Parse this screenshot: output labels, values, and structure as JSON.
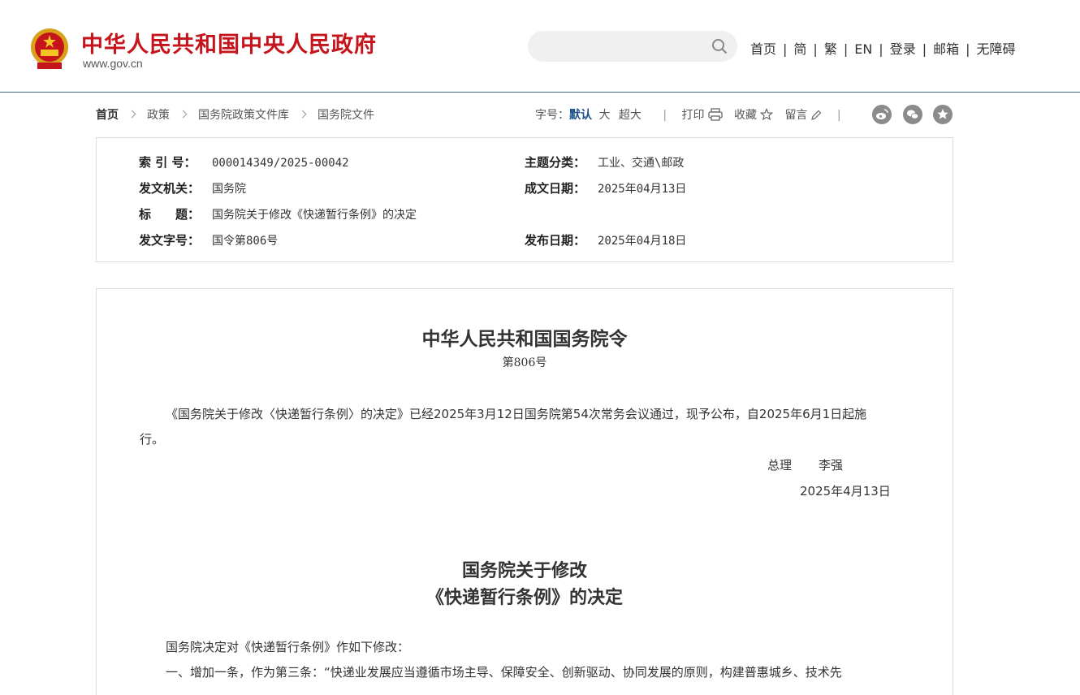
{
  "header": {
    "site_title": "中华人民共和国中央人民政府",
    "site_url": "www.gov.cn",
    "search": {
      "placeholder": "",
      "icon": "search-icon"
    },
    "nav": [
      "首页",
      "简",
      "繁",
      "EN",
      "登录",
      "邮箱",
      "无障碍"
    ]
  },
  "breadcrumb": [
    "首页",
    "政策",
    "国务院政策文件库",
    "国务院文件"
  ],
  "tools": {
    "font_size_label": "字号：",
    "font_sizes": [
      "默认",
      "大",
      "超大"
    ],
    "print": "打印",
    "favorite": "收藏",
    "comment": "留言",
    "share_icons": [
      "weibo-icon",
      "wechat-icon",
      "star-icon"
    ]
  },
  "info": {
    "index_label": "索 引 号：",
    "index_value": "000014349/2025-00042",
    "category_label": "主题分类：",
    "category_value": "工业、交通\\邮政",
    "issuer_label": "发文机关：",
    "issuer_value": "国务院",
    "written_label": "成文日期：",
    "written_value": "2025年04月13日",
    "title_label": "标　　题：",
    "title_value": "国务院关于修改《快递暂行条例》的决定",
    "docno_label": "发文字号：",
    "docno_value": "国令第806号",
    "published_label": "发布日期：",
    "published_value": "2025年04月18日"
  },
  "article": {
    "order_title": "中华人民共和国国务院令",
    "order_no": "第806号",
    "para1_line1": "《国务院关于修改〈快递暂行条例〉的决定》已经2025年3月12日国务院第54次常务会议通过，现予公布，自2025年6月1日起施",
    "para1_line2": "行。",
    "signer_title": "总理",
    "signer_name": "李强",
    "sign_date": "2025年4月13日",
    "decision_title_1": "国务院关于修改",
    "decision_title_2": "《快递暂行条例》的决定",
    "body_line1": "国务院决定对《快递暂行条例》作如下修改：",
    "body_line2": "一、增加一条，作为第三条：“快递业发展应当遵循市场主导、保障安全、创新驱动、协同发展的原则，构建普惠城乡、技术先"
  },
  "colors": {
    "brand_red": "#c5141b",
    "link_blue": "#1c4f8a"
  }
}
